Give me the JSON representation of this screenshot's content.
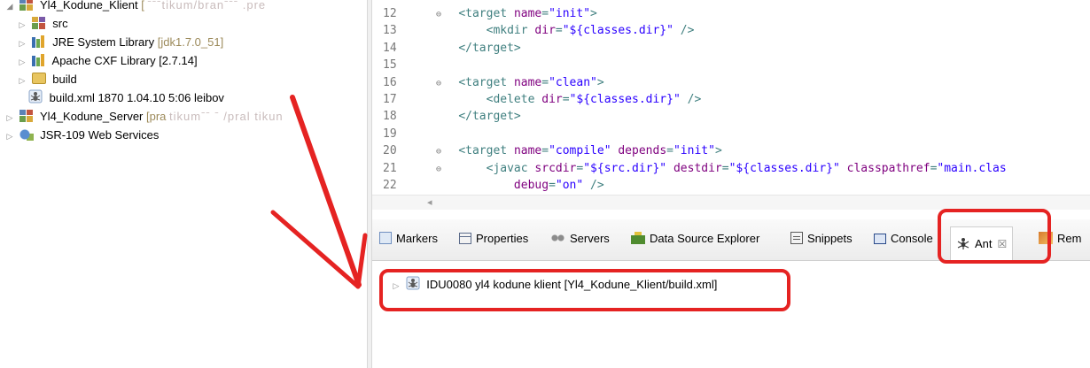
{
  "explorer": {
    "items": [
      {
        "twisty": "◢",
        "icon": "project-icon",
        "label": "Yl4_Kodune_Klient",
        "deco": "[",
        "blurred": "ˉˉˉtikum/branˉˉˉ  .pre"
      },
      {
        "twisty": "▷",
        "icon": "package-icon",
        "label": "src"
      },
      {
        "twisty": "▷",
        "icon": "library-icon",
        "label": "JRE System Library",
        "deco": "[jdk1.7.0_51]"
      },
      {
        "twisty": "▷",
        "icon": "library-icon",
        "label": "Apache CXF Library [2.7.14]"
      },
      {
        "twisty": "▷",
        "icon": "folder-icon",
        "label": "build"
      },
      {
        "twisty": "",
        "icon": "ant-file-icon",
        "label": "build.xml 1870  1.04.10 5:06  leibov"
      },
      {
        "twisty": "▷",
        "icon": "project-icon",
        "label": "Yl4_Kodune_Server",
        "deco": "[pra",
        "blurred": " tikumˉˉ   ˉ  /pral tikun"
      },
      {
        "twisty": "▷",
        "icon": "webservices-icon",
        "label": "JSR-109 Web Services"
      }
    ]
  },
  "editor": {
    "lines": [
      {
        "num": "12",
        "fold": "⊖",
        "indent": "    ",
        "parts": [
          [
            "tag",
            "<target "
          ],
          [
            "attr",
            "name"
          ],
          [
            "tag",
            "="
          ],
          [
            "str",
            "\"init\""
          ],
          [
            "tag",
            ">"
          ]
        ]
      },
      {
        "num": "13",
        "fold": "",
        "indent": "        ",
        "parts": [
          [
            "tag",
            "<mkdir "
          ],
          [
            "attr",
            "dir"
          ],
          [
            "tag",
            "="
          ],
          [
            "str",
            "\"${classes.dir}\""
          ],
          [
            "tag",
            " />"
          ]
        ]
      },
      {
        "num": "14",
        "fold": "",
        "indent": "    ",
        "parts": [
          [
            "tag",
            "</target>"
          ]
        ]
      },
      {
        "num": "15",
        "fold": "",
        "indent": "",
        "parts": []
      },
      {
        "num": "16",
        "fold": "⊖",
        "indent": "    ",
        "parts": [
          [
            "tag",
            "<target "
          ],
          [
            "attr",
            "name"
          ],
          [
            "tag",
            "="
          ],
          [
            "str",
            "\"clean\""
          ],
          [
            "tag",
            ">"
          ]
        ]
      },
      {
        "num": "17",
        "fold": "",
        "indent": "        ",
        "parts": [
          [
            "tag",
            "<delete "
          ],
          [
            "attr",
            "dir"
          ],
          [
            "tag",
            "="
          ],
          [
            "str",
            "\"${classes.dir}\""
          ],
          [
            "tag",
            " />"
          ]
        ]
      },
      {
        "num": "18",
        "fold": "",
        "indent": "    ",
        "parts": [
          [
            "tag",
            "</target>"
          ]
        ]
      },
      {
        "num": "19",
        "fold": "",
        "indent": "",
        "parts": []
      },
      {
        "num": "20",
        "fold": "⊖",
        "indent": "    ",
        "parts": [
          [
            "tag",
            "<target "
          ],
          [
            "attr",
            "name"
          ],
          [
            "tag",
            "="
          ],
          [
            "str",
            "\"compile\""
          ],
          [
            "tag",
            " "
          ],
          [
            "attr",
            "depends"
          ],
          [
            "tag",
            "="
          ],
          [
            "str",
            "\"init\""
          ],
          [
            "tag",
            ">"
          ]
        ]
      },
      {
        "num": "21",
        "fold": "⊖",
        "indent": "        ",
        "parts": [
          [
            "tag",
            "<javac "
          ],
          [
            "attr",
            "srcdir"
          ],
          [
            "tag",
            "="
          ],
          [
            "str",
            "\"${src.dir}\""
          ],
          [
            "tag",
            " "
          ],
          [
            "attr",
            "destdir"
          ],
          [
            "tag",
            "="
          ],
          [
            "str",
            "\"${classes.dir}\""
          ],
          [
            "tag",
            " "
          ],
          [
            "attr",
            "classpathref"
          ],
          [
            "tag",
            "="
          ],
          [
            "str",
            "\"main.clas"
          ]
        ]
      },
      {
        "num": "22",
        "fold": "",
        "indent": "            ",
        "parts": [
          [
            "attr",
            "debug"
          ],
          [
            "tag",
            "="
          ],
          [
            "str",
            "\"on\""
          ],
          [
            "tag",
            " />"
          ]
        ]
      }
    ],
    "scroll_left": "◂"
  },
  "views": {
    "tabs": [
      {
        "icon": "markers-icon",
        "label": "Markers"
      },
      {
        "icon": "properties-icon",
        "label": "Properties"
      },
      {
        "icon": "servers-icon",
        "label": "Servers"
      },
      {
        "icon": "data-source-icon",
        "label": "Data Source Explorer"
      },
      {
        "icon": "snippets-icon",
        "label": "Snippets"
      },
      {
        "icon": "console-icon",
        "label": "Console"
      },
      {
        "icon": "ant-icon",
        "label": "Ant",
        "close": "☒",
        "active": true
      },
      {
        "icon": "remote-icon",
        "label": "Rem"
      }
    ],
    "ant_entry": {
      "twisty": "▷",
      "label": "IDU0080 yl4 kodune klient  [Yl4_Kodune_Klient/build.xml]"
    }
  },
  "colors": {
    "annotation_red": "#e52322",
    "xml_tag": "#3f7f7f",
    "xml_attr": "#7f007f",
    "xml_string": "#2a00ff"
  }
}
